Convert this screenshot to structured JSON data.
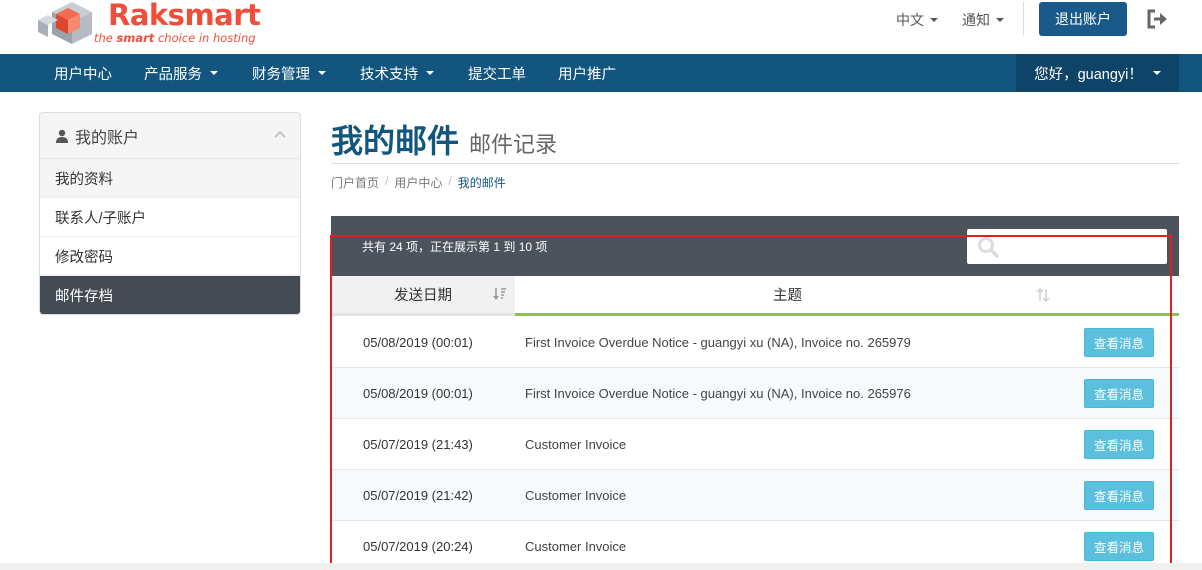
{
  "brand": {
    "name": "Raksmart",
    "tagline_prefix": "the ",
    "tagline_bold": "smart",
    "tagline_suffix": " choice in hosting",
    "color": "#ef4e3b"
  },
  "topbar": {
    "language": "中文",
    "notifications": "通知",
    "logout": "退出账户",
    "exit_icon": "sign-out-icon"
  },
  "nav": {
    "items": [
      {
        "label": "用户中心",
        "dropdown": false
      },
      {
        "label": "产品服务",
        "dropdown": true
      },
      {
        "label": "财务管理",
        "dropdown": true
      },
      {
        "label": "技术支持",
        "dropdown": true
      },
      {
        "label": "提交工单",
        "dropdown": false
      },
      {
        "label": "用户推广",
        "dropdown": false
      }
    ],
    "user_greeting": "您好，guangyi！",
    "bg_color": "#12557f"
  },
  "sidebar": {
    "title": "我的账户",
    "items": [
      {
        "label": "我的资料"
      },
      {
        "label": "联系人/子账户"
      },
      {
        "label": "修改密码"
      },
      {
        "label": "邮件存档",
        "active": true
      }
    ]
  },
  "page": {
    "title": "我的邮件",
    "subtitle": "邮件记录",
    "breadcrumb": [
      "门户首页",
      "用户中心",
      "我的邮件"
    ]
  },
  "table": {
    "summary": "共有 24 项，正在展示第 1 到 10 项",
    "search_placeholder": "",
    "headers": {
      "date": "发送日期",
      "subject": "主题"
    },
    "rows": [
      {
        "date": "05/08/2019 (00:01)",
        "subject": "First Invoice Overdue Notice - guangyi xu (NA), Invoice no. 265979",
        "action": "查看消息"
      },
      {
        "date": "05/08/2019 (00:01)",
        "subject": "First Invoice Overdue Notice - guangyi xu (NA), Invoice no. 265976",
        "action": "查看消息"
      },
      {
        "date": "05/07/2019 (21:43)",
        "subject": "Customer Invoice",
        "action": "查看消息"
      },
      {
        "date": "05/07/2019 (21:42)",
        "subject": "Customer Invoice",
        "action": "查看消息"
      },
      {
        "date": "05/07/2019 (20:24)",
        "subject": "Customer Invoice",
        "action": "查看消息"
      }
    ]
  }
}
